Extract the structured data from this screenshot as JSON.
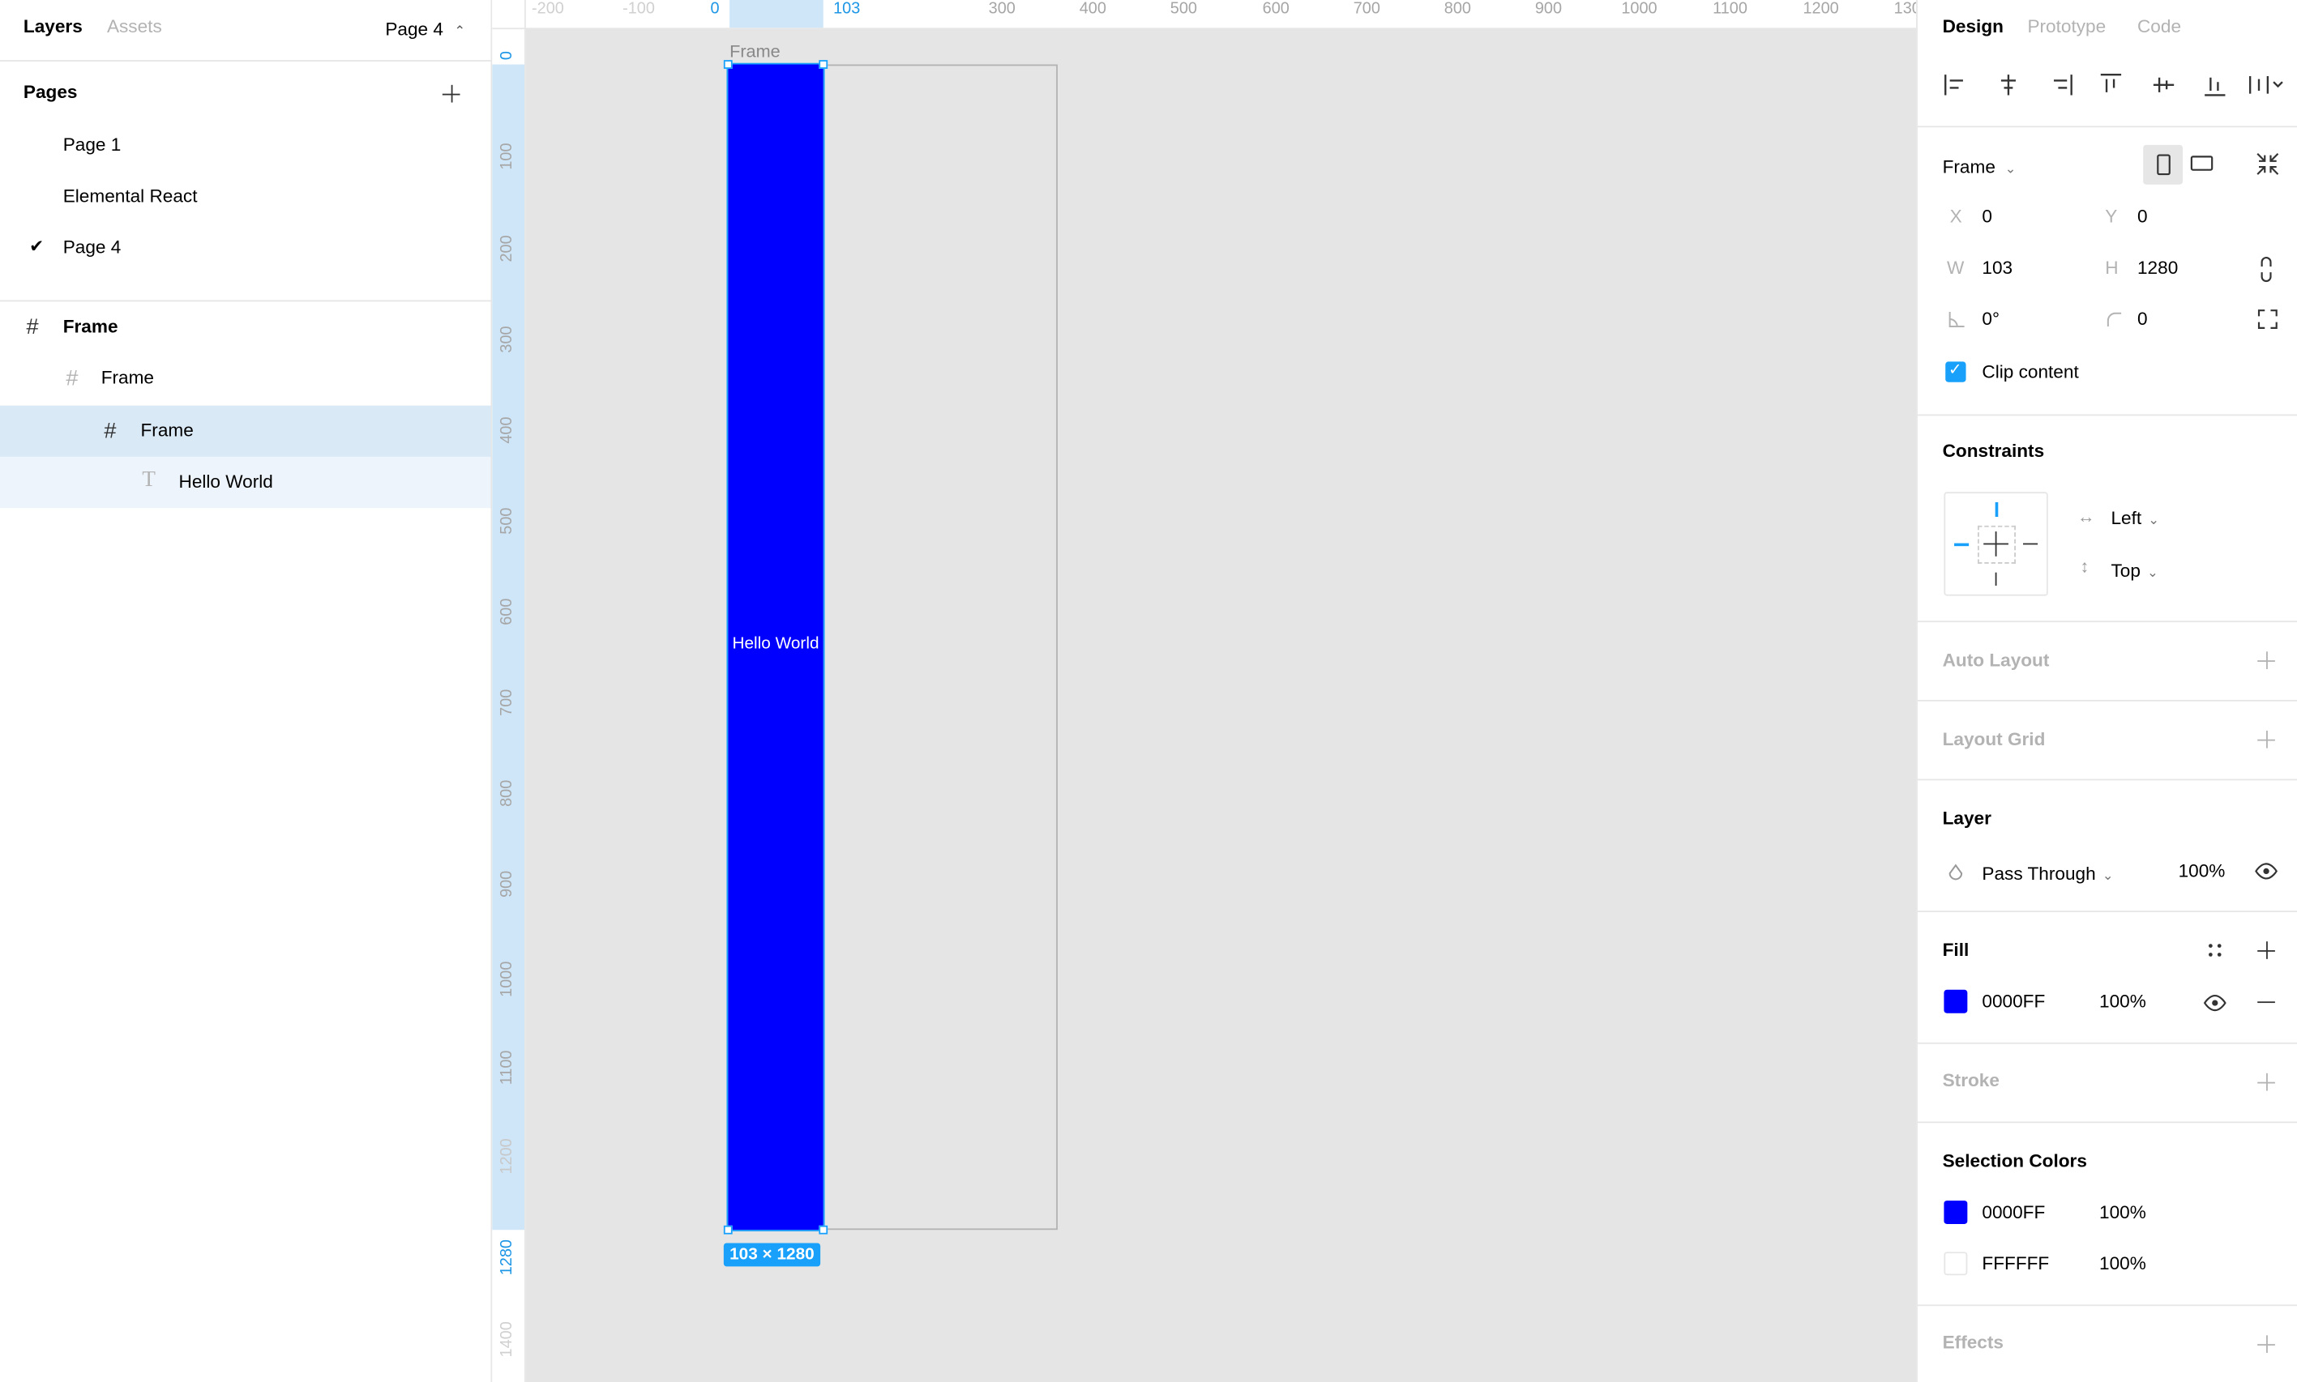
{
  "left_panel": {
    "tabs": {
      "layers": "Layers",
      "assets": "Assets",
      "page_selector": "Page 4"
    },
    "pages_title": "Pages",
    "pages": [
      "Page 1",
      "Elemental React",
      "Page 4"
    ],
    "layers": [
      "Frame",
      "Frame",
      "Frame",
      "Hello World"
    ]
  },
  "rulers": {
    "top": [
      "-200",
      "-100",
      "0",
      "103",
      "300",
      "400",
      "500",
      "600",
      "700",
      "800",
      "900",
      "1000",
      "1100",
      "1200",
      "130"
    ],
    "left": [
      "0",
      "100",
      "200",
      "300",
      "400",
      "500",
      "600",
      "700",
      "800",
      "900",
      "1000",
      "1100",
      "1200",
      "1280",
      "1400"
    ]
  },
  "canvas": {
    "frame_label": "Frame",
    "text": "Hello World",
    "size_badge": "103 × 1280",
    "fill_color": "#0000FF"
  },
  "right_panel": {
    "tabs": {
      "design": "Design",
      "prototype": "Prototype",
      "code": "Code"
    },
    "frame_type": "Frame",
    "x_label": "X",
    "x_value": "0",
    "y_label": "Y",
    "y_value": "0",
    "w_label": "W",
    "w_value": "103",
    "h_label": "H",
    "h_value": "1280",
    "rotation": "0°",
    "radius": "0",
    "clip_content": "Clip content",
    "constraints_title": "Constraints",
    "constraint_h": "Left",
    "constraint_v": "Top",
    "auto_layout": "Auto Layout",
    "layout_grid": "Layout Grid",
    "layer_title": "Layer",
    "blend_mode": "Pass Through",
    "layer_opacity": "100%",
    "fill_title": "Fill",
    "fill_hex": "0000FF",
    "fill_opacity": "100%",
    "stroke_title": "Stroke",
    "selection_colors_title": "Selection Colors",
    "selection_colors": [
      {
        "hex": "0000FF",
        "opacity": "100%",
        "color": "#0000FF"
      },
      {
        "hex": "FFFFFF",
        "opacity": "100%",
        "color": "#FFFFFF"
      }
    ],
    "effects_title": "Effects"
  }
}
